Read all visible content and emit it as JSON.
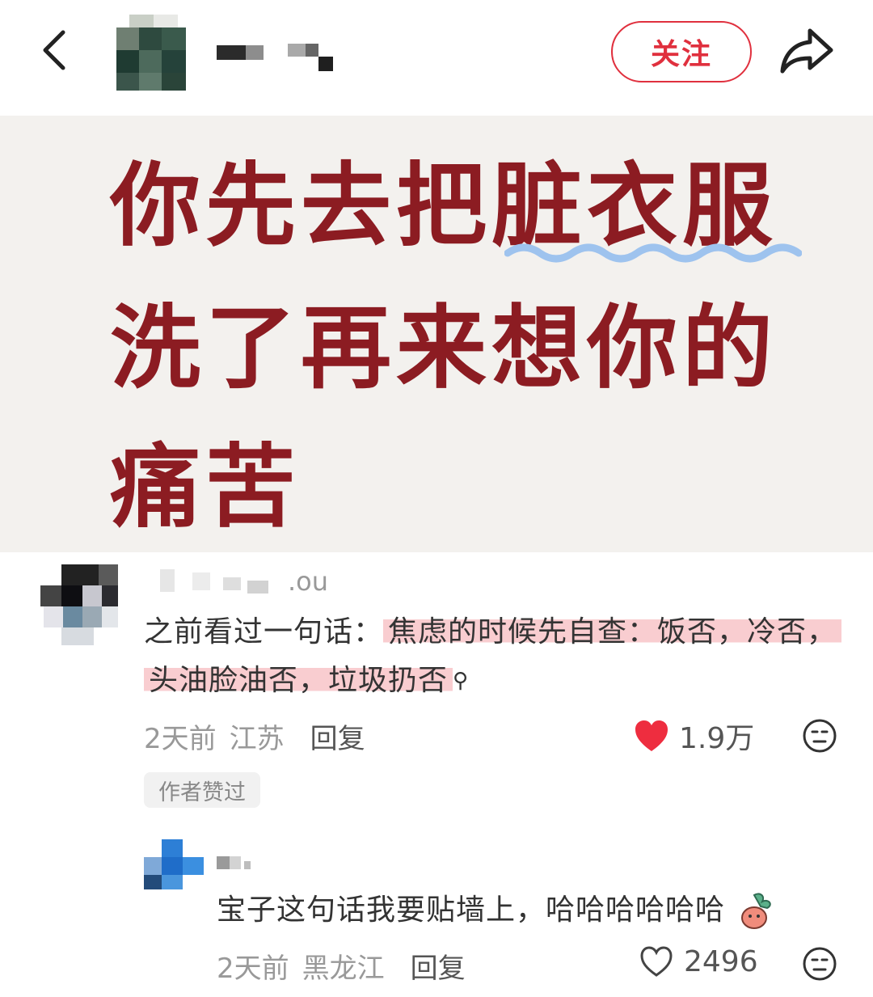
{
  "header": {
    "back_icon": "chevron-left-icon",
    "follow_label": "关注",
    "share_icon": "share-arrow-icon",
    "accent_color": "#e0303e"
  },
  "note": {
    "lines": [
      "你先去把脏衣服",
      "洗了再来想你的",
      "痛苦"
    ],
    "text_color": "#8c1c22",
    "background_color": "#f3f1ee",
    "underline_color": "#9ec3ee"
  },
  "comments": [
    {
      "name_suffix": ".ou",
      "text_prefix": "之前看过一句话：",
      "text_highlight": "焦虑的时候先自查：饭否，冷否，头油脸油否，垃圾扔否",
      "time": "2天前",
      "location": "江苏",
      "reply_label": "回复",
      "likes": "1.9万",
      "liked": true,
      "badge": "作者赞过"
    }
  ],
  "reply": {
    "text": "宝子这句话我要贴墙上，哈哈哈哈哈哈",
    "time": "2天前",
    "location": "黑龙江",
    "reply_label": "回复",
    "likes": "2496",
    "liked": false
  }
}
